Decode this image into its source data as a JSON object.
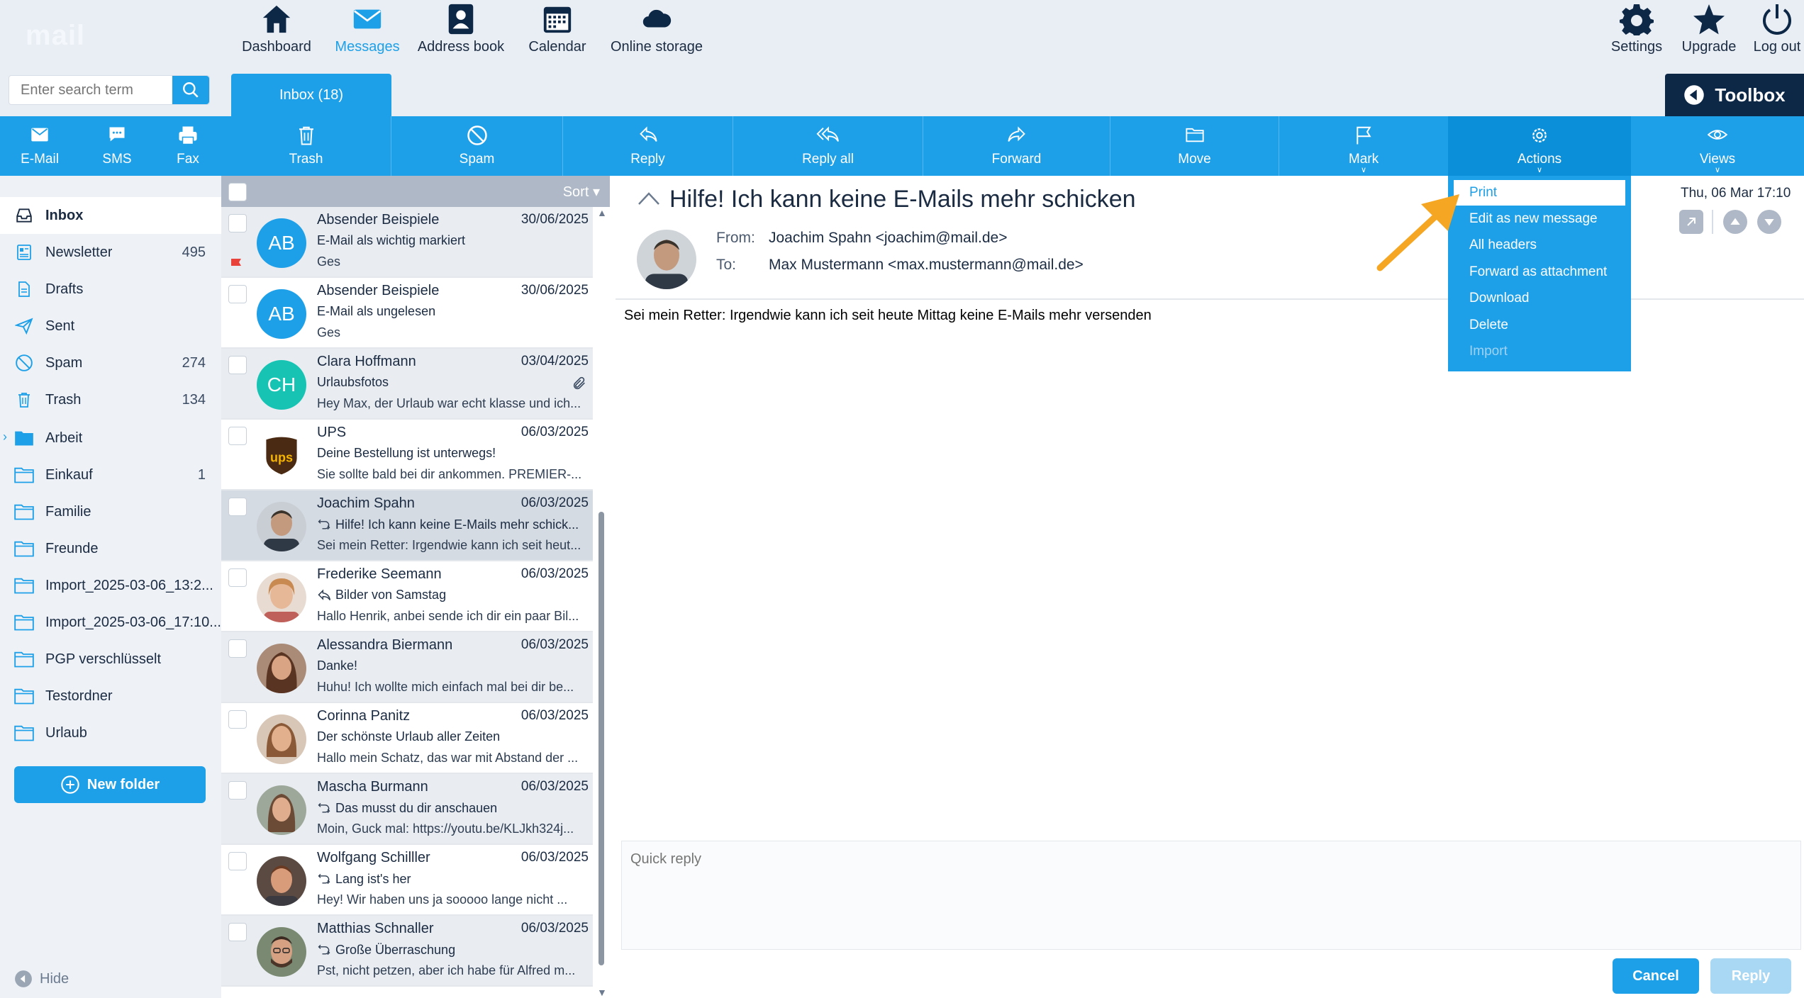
{
  "app": {
    "logo_text": "mail"
  },
  "search": {
    "placeholder": "Enter search term"
  },
  "topnav": {
    "items": [
      {
        "label": "Dashboard",
        "icon": "home-icon"
      },
      {
        "label": "Messages",
        "icon": "envelope-icon",
        "active": true
      },
      {
        "label": "Address book",
        "icon": "contact-icon"
      },
      {
        "label": "Calendar",
        "icon": "calendar-icon"
      },
      {
        "label": "Online storage",
        "icon": "cloud-icon"
      }
    ],
    "right": [
      {
        "label": "Settings",
        "icon": "gear-icon"
      },
      {
        "label": "Upgrade",
        "icon": "star-icon"
      },
      {
        "label": "Log out",
        "icon": "power-icon"
      }
    ]
  },
  "tabs": {
    "inbox": "Inbox (18)",
    "toolbox": "Toolbox"
  },
  "toolbar": {
    "email": "E-Mail",
    "sms": "SMS",
    "fax": "Fax",
    "trash": "Trash",
    "spam": "Spam",
    "reply": "Reply",
    "reply_all": "Reply all",
    "forward": "Forward",
    "move": "Move",
    "mark": "Mark",
    "actions": "Actions",
    "views": "Views"
  },
  "folders": [
    {
      "label": "Inbox",
      "count": "",
      "icon": "inbox-icon",
      "active": true
    },
    {
      "label": "Newsletter",
      "count": "495",
      "icon": "newsletter-icon"
    },
    {
      "label": "Drafts",
      "count": "",
      "icon": "draft-icon"
    },
    {
      "label": "Sent",
      "count": "",
      "icon": "send-icon"
    },
    {
      "label": "Spam",
      "count": "274",
      "icon": "spam-icon"
    },
    {
      "label": "Trash",
      "count": "134",
      "icon": "trash-icon"
    },
    {
      "label": "Arbeit",
      "count": "",
      "icon": "folder-icon"
    },
    {
      "label": "Einkauf",
      "count": "1",
      "icon": "folder-icon"
    },
    {
      "label": "Familie",
      "count": "",
      "icon": "folder-icon"
    },
    {
      "label": "Freunde",
      "count": "",
      "icon": "folder-icon"
    },
    {
      "label": "Import_2025-03-06_13:2...",
      "count": "",
      "icon": "folder-icon"
    },
    {
      "label": "Import_2025-03-06_17:10...",
      "count": "",
      "icon": "folder-icon"
    },
    {
      "label": "PGP verschlüsselt",
      "count": "",
      "icon": "folder-icon"
    },
    {
      "label": "Testordner",
      "count": "",
      "icon": "folder-icon"
    },
    {
      "label": "Urlaub",
      "count": "",
      "icon": "folder-icon"
    }
  ],
  "new_folder": "New folder",
  "hide": "Hide",
  "list": {
    "sort": "Sort"
  },
  "messages": [
    {
      "sender": "Absender Beispiele",
      "date": "30/06/2025",
      "subject": "E-Mail als wichtig markiert",
      "preview": "Ges",
      "initials": "AB",
      "color": "#1ea0e8"
    },
    {
      "sender": "Absender Beispiele",
      "date": "30/06/2025",
      "subject": "E-Mail als ungelesen",
      "preview": "Ges",
      "initials": "AB",
      "color": "#1ea0e8"
    },
    {
      "sender": "Clara Hoffmann",
      "date": "03/04/2025",
      "subject": "Urlaubsfotos",
      "preview": "Hey Max, der Urlaub war echt klasse und ich...",
      "initials": "CH",
      "color": "#17c4b4"
    },
    {
      "sender": "UPS",
      "date": "06/03/2025",
      "subject": "Deine Bestellung ist unterwegs!",
      "preview": "Sie sollte bald bei dir ankommen. PREMIER-...",
      "initials": "ups",
      "color": "#4a2a12"
    },
    {
      "sender": "Joachim Spahn",
      "date": "06/03/2025",
      "subject": "Hilfe! Ich kann keine E-Mails mehr schick...",
      "preview": "Sei mein Retter: Irgendwie kann ich seit heut...",
      "color": "#6d6a66"
    },
    {
      "sender": "Frederike Seemann",
      "date": "06/03/2025",
      "subject": "Bilder von Samstag",
      "preview": "Hallo Henrik, anbei sende ich dir ein paar Bil...",
      "color": "#d9a57a"
    },
    {
      "sender": "Alessandra Biermann",
      "date": "06/03/2025",
      "subject": "Danke!",
      "preview": "Huhu! Ich wollte mich einfach mal bei dir be...",
      "color": "#7a4a32"
    },
    {
      "sender": "Corinna Panitz",
      "date": "06/03/2025",
      "subject": "Der schönste Urlaub aller Zeiten",
      "preview": "Hallo mein Schatz, das war mit Abstand der ...",
      "color": "#b78a6a"
    },
    {
      "sender": "Mascha Burmann",
      "date": "06/03/2025",
      "subject": "Das musst du dir anschauen",
      "preview": "Moin, Guck mal: https://youtu.be/KLJkh324j...",
      "color": "#8c6a55"
    },
    {
      "sender": "Wolfgang Schilller",
      "date": "06/03/2025",
      "subject": "Lang ist's her",
      "preview": "Hey! Wir haben uns ja sooooo lange nicht ...",
      "color": "#a9775c"
    },
    {
      "sender": "Matthias Schnaller",
      "date": "06/03/2025",
      "subject": "Große Überraschung",
      "preview": "Pst, nicht petzen, aber ich habe für Alfred m...",
      "color": "#6b5a4a"
    }
  ],
  "reader": {
    "subject": "Hilfe! Ich kann keine E-Mails mehr schicken",
    "from_label": "From:",
    "from": "Joachim Spahn <joachim@mail.de>",
    "to_label": "To:",
    "to": "Max Mustermann <max.mustermann@mail.de>",
    "date": "Thu, 06 Mar 17:10",
    "body": "Sei mein Retter: Irgendwie kann ich seit heute Mittag keine E-Mails mehr versenden"
  },
  "actions_menu": [
    {
      "label": "Print",
      "highlighted": true
    },
    {
      "label": "Edit as new message"
    },
    {
      "label": "All headers"
    },
    {
      "label": "Forward as attachment"
    },
    {
      "label": "Download"
    },
    {
      "label": "Delete"
    },
    {
      "label": "Import",
      "disabled": true
    }
  ],
  "quick_reply": {
    "placeholder": "Quick reply",
    "cancel": "Cancel",
    "reply": "Reply"
  },
  "colors": {
    "accent": "#1ea0e8",
    "dark": "#0d2746",
    "annotation_arrow": "#f5a623"
  }
}
